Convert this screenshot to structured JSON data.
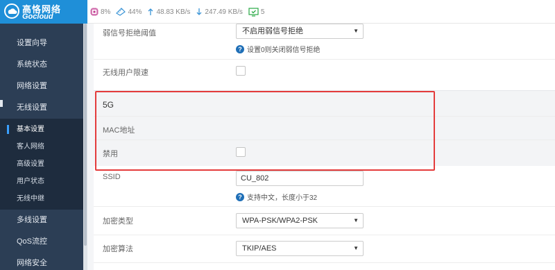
{
  "brand": {
    "name_cn": "高恪网络",
    "name_en": "Gocloud"
  },
  "status": {
    "cpu": "8%",
    "memory": "44%",
    "upload": "48.83 KB/s",
    "download": "247.49 KB/s",
    "devices": "5"
  },
  "sidebar": {
    "items": [
      "设置向导",
      "系统状态",
      "网络设置",
      "无线设置"
    ],
    "sub_items": [
      "基本设置",
      "客人网络",
      "高级设置",
      "用户状态",
      "无线中继"
    ],
    "items_after": [
      "多线设置",
      "QoS流控",
      "网络安全"
    ]
  },
  "form": {
    "weak_signal": {
      "label": "弱信号拒绝阈值",
      "value": "不启用弱信号拒绝",
      "hint": "设置0则关闭弱信号拒绝"
    },
    "wireless_limit": {
      "label": "无线用户限速"
    },
    "band_5g": {
      "title": "5G",
      "mac_label": "MAC地址",
      "disable_label": "禁用"
    },
    "ssid": {
      "label": "SSID",
      "value": "CU_802",
      "hint": "支持中文，长度小于32"
    },
    "encryption_type": {
      "label": "加密类型",
      "value": "WPA-PSK/WPA2-PSK"
    },
    "encryption_algo": {
      "label": "加密算法",
      "value": "TKIP/AES"
    }
  },
  "colors": {
    "brand": "#1f8fd8",
    "sidebar": "#2c3e55",
    "highlight": "#e43b3b",
    "accent": "#3aa0ff"
  }
}
